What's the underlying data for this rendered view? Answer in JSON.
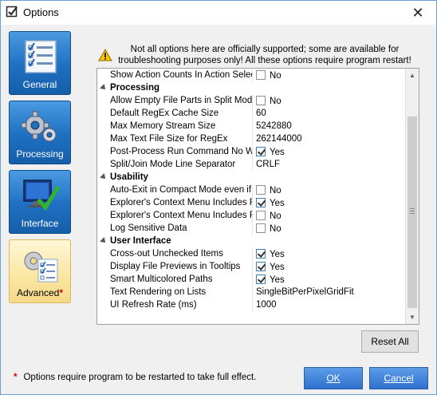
{
  "window": {
    "title": "Options",
    "close_glyph": "✕"
  },
  "nav": {
    "items": [
      {
        "label": "General",
        "icon": "checklist-icon"
      },
      {
        "label": "Processing",
        "icon": "gears-icon"
      },
      {
        "label": "Interface",
        "icon": "monitor-check-icon"
      },
      {
        "label": "Advanced",
        "icon": "gear-checklist-icon",
        "marker": "*"
      }
    ],
    "selected": "Advanced"
  },
  "warning": {
    "text": "Not all options here are officially supported; some are available for troubleshooting purposes only! All these options require program restart!"
  },
  "grid": {
    "rows": [
      {
        "type": "prop",
        "name": "Show Action Counts In Action Select",
        "check": false,
        "value": "No"
      },
      {
        "type": "cat",
        "name": "Processing"
      },
      {
        "type": "prop",
        "name": "Allow Empty File Parts in Split Mode",
        "check": false,
        "value": "No"
      },
      {
        "type": "prop",
        "name": "Default RegEx Cache Size",
        "value": "60"
      },
      {
        "type": "prop",
        "name": "Max Memory Stream Size",
        "value": "5242880"
      },
      {
        "type": "prop",
        "name": "Max Text File Size for RegEx",
        "value": "262144000"
      },
      {
        "type": "prop",
        "name": "Post-Process Run Command No Wi",
        "check": true,
        "value": "Yes"
      },
      {
        "type": "prop",
        "name": "Split/Join Mode Line Separator",
        "value": "CRLF"
      },
      {
        "type": "cat",
        "name": "Usability"
      },
      {
        "type": "prop",
        "name": "Auto-Exit in Compact Mode even if",
        "check": false,
        "value": "No"
      },
      {
        "type": "prop",
        "name": "Explorer's Context Menu Includes F",
        "check": true,
        "value": "Yes"
      },
      {
        "type": "prop",
        "name": "Explorer's Context Menu Includes F",
        "check": false,
        "value": "No"
      },
      {
        "type": "prop",
        "name": "Log Sensitive Data",
        "check": false,
        "value": "No"
      },
      {
        "type": "cat",
        "name": "User Interface"
      },
      {
        "type": "prop",
        "name": "Cross-out Unchecked Items",
        "check": true,
        "value": "Yes"
      },
      {
        "type": "prop",
        "name": "Display File Previews in Tooltips",
        "check": true,
        "value": "Yes"
      },
      {
        "type": "prop",
        "name": "Smart Multicolored Paths",
        "check": true,
        "value": "Yes"
      },
      {
        "type": "prop",
        "name": "Text Rendering on Lists",
        "value": "SingleBitPerPixelGridFit"
      },
      {
        "type": "prop",
        "name": "UI Refresh Rate (ms)",
        "value": "1000"
      }
    ]
  },
  "buttons": {
    "reset": "Reset All",
    "ok": "OK",
    "cancel": "Cancel"
  },
  "footnote": {
    "marker": "*",
    "text": "Options require program to be restarted to take full effect."
  },
  "colors": {
    "accent": "#2e6fcf",
    "nav_blue": "#1f6fc2",
    "selected": "#fbe6a0",
    "required_marker": "#d60000"
  }
}
